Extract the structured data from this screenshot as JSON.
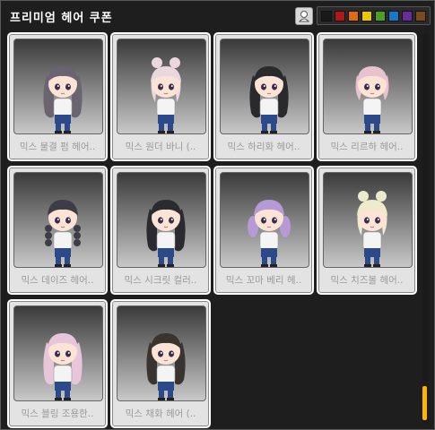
{
  "window": {
    "title": "프리미엄 헤어 쿠폰",
    "color_swatches": [
      "#1a1a1a",
      "#b01818",
      "#e06a10",
      "#e8c800",
      "#50a020",
      "#1878c8",
      "#6a2aa0",
      "#7a4a20"
    ]
  },
  "coupons": [
    {
      "label": "믹스 물결 펌 헤어..",
      "hair_color": "#6a6470",
      "style": "wavy"
    },
    {
      "label": "믹스 원더 바니 (..",
      "hair_color": "#ead8de",
      "style": "bun"
    },
    {
      "label": "믹스 하리화 헤어..",
      "hair_color": "#2a2a2c",
      "style": "wavy"
    },
    {
      "label": "믹스 리르하 헤어..",
      "hair_color": "#e8c2cc",
      "style": "short"
    },
    {
      "label": "믹스 데이즈 헤어..",
      "hair_color": "#3e3c46",
      "style": "braid"
    },
    {
      "label": "믹스 시크릿 컬러..",
      "hair_color": "#2a2a30",
      "style": "long"
    },
    {
      "label": "믹스 꼬마 베리 헤..",
      "hair_color": "#b69ad6",
      "style": "twin"
    },
    {
      "label": "믹스 치즈볼 헤어..",
      "hair_color": "#eeeacc",
      "style": "bun"
    },
    {
      "label": "믹스 블링 조용한..",
      "hair_color": "#e6c6d8",
      "style": "long"
    },
    {
      "label": "믹스 채화 헤어 (..",
      "hair_color": "#3a3430",
      "style": "wavy"
    }
  ]
}
